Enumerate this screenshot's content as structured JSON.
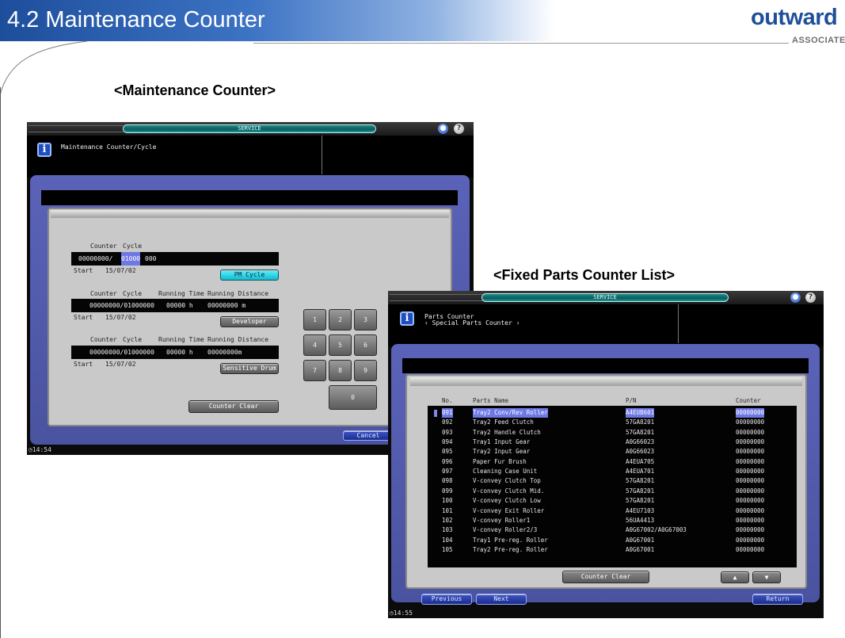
{
  "slide": {
    "title": "4.2 Maintenance Counter",
    "logo_main": "outward",
    "logo_sub": "ASSOCIATES",
    "caption_left": "<Maintenance Counter>",
    "caption_right": "<Fixed Parts Counter List>"
  },
  "colors": {
    "header_blue": "#1d4e9c",
    "frame_blue": "#5a63b8",
    "selection": "#6e78e4",
    "service_teal": "#1aa0a0"
  },
  "left_screen": {
    "mode_label": "SERVICE",
    "screen_title": "Maintenance Counter/Cycle",
    "info_icon": "info-icon",
    "blocks": [
      {
        "headers": {
          "counter": "Counter",
          "cycle": "Cycle"
        },
        "value_prefix": "00000000/",
        "value_selected": "01000",
        "value_suffix": "000",
        "start_label": "Start",
        "start_date": "15/07/02",
        "button": "PM Cycle"
      },
      {
        "headers": {
          "counter": "Counter",
          "cycle": "Cycle",
          "running_time": "Running Time",
          "running_distance": "Running Distance"
        },
        "value": "00000000/01000000",
        "time": "00000 h",
        "distance": "00000000 m",
        "start_label": "Start",
        "start_date": "15/07/02",
        "button": "Developer"
      },
      {
        "headers": {
          "counter": "Counter",
          "cycle": "Cycle",
          "running_time": "Running Time",
          "running_distance": "Running Distance"
        },
        "value": "00000000/01000000",
        "time": "00000 h",
        "distance": "00000000m",
        "start_label": "Start",
        "start_date": "15/07/02",
        "button": "Sensitive Drum"
      }
    ],
    "keypad": [
      "1",
      "2",
      "3",
      "4",
      "5",
      "6",
      "7",
      "8",
      "9",
      "0"
    ],
    "counter_clear": "Counter Clear",
    "cancel": "Cancel",
    "clock": "14:54"
  },
  "right_screen": {
    "mode_label": "SERVICE",
    "title_line1": "Parts Counter",
    "title_line2": "‹ Special Parts Counter ›",
    "columns": {
      "no": "No.",
      "parts_name": "Parts Name",
      "pn": "P/N",
      "counter": "Counter"
    },
    "rows": [
      {
        "no": "091",
        "name": "Tray2 Conv/Rev Roller",
        "pn": "A4EUB601",
        "counter": "00000000",
        "selected": true
      },
      {
        "no": "092",
        "name": "Tray2 Feed Clutch",
        "pn": "57GA8201",
        "counter": "00000000"
      },
      {
        "no": "093",
        "name": "Tray2 Handle Clutch",
        "pn": "57GA8201",
        "counter": "00000000"
      },
      {
        "no": "094",
        "name": "Tray1 Input Gear",
        "pn": "A0G66023",
        "counter": "00000000"
      },
      {
        "no": "095",
        "name": "Tray2 Input Gear",
        "pn": "A0G66023",
        "counter": "00000000"
      },
      {
        "no": "096",
        "name": "Paper Fur Brush",
        "pn": "A4EUA705",
        "counter": "00000000"
      },
      {
        "no": "097",
        "name": "Cleaning Case Unit",
        "pn": "A4EUA701",
        "counter": "00000000"
      },
      {
        "no": "098",
        "name": "V-convey Clutch Top",
        "pn": "57GA8201",
        "counter": "00000000"
      },
      {
        "no": "099",
        "name": "V-convey Clutch Mid.",
        "pn": "57GA8201",
        "counter": "00000000"
      },
      {
        "no": "100",
        "name": "V-convey Clutch Low",
        "pn": "57GA8201",
        "counter": "00000000"
      },
      {
        "no": "101",
        "name": "V-convey Exit Roller",
        "pn": "A4EU7103",
        "counter": "00000000"
      },
      {
        "no": "102",
        "name": "V-convey Roller1",
        "pn": "56UA4413",
        "counter": "00000000"
      },
      {
        "no": "103",
        "name": "V-convey Roller2/3",
        "pn": "A0G67002/A0G67003",
        "counter": "00000000"
      },
      {
        "no": "104",
        "name": "Tray1 Pre-reg. Roller",
        "pn": "A0G67001",
        "counter": "00000000"
      },
      {
        "no": "105",
        "name": "Tray2 Pre-reg. Roller",
        "pn": "A0G67001",
        "counter": "00000000"
      }
    ],
    "counter_clear": "Counter Clear",
    "up": "▲",
    "down": "▼",
    "previous": "Previous",
    "next": "Next",
    "return": "Return",
    "clock": "14:55"
  }
}
